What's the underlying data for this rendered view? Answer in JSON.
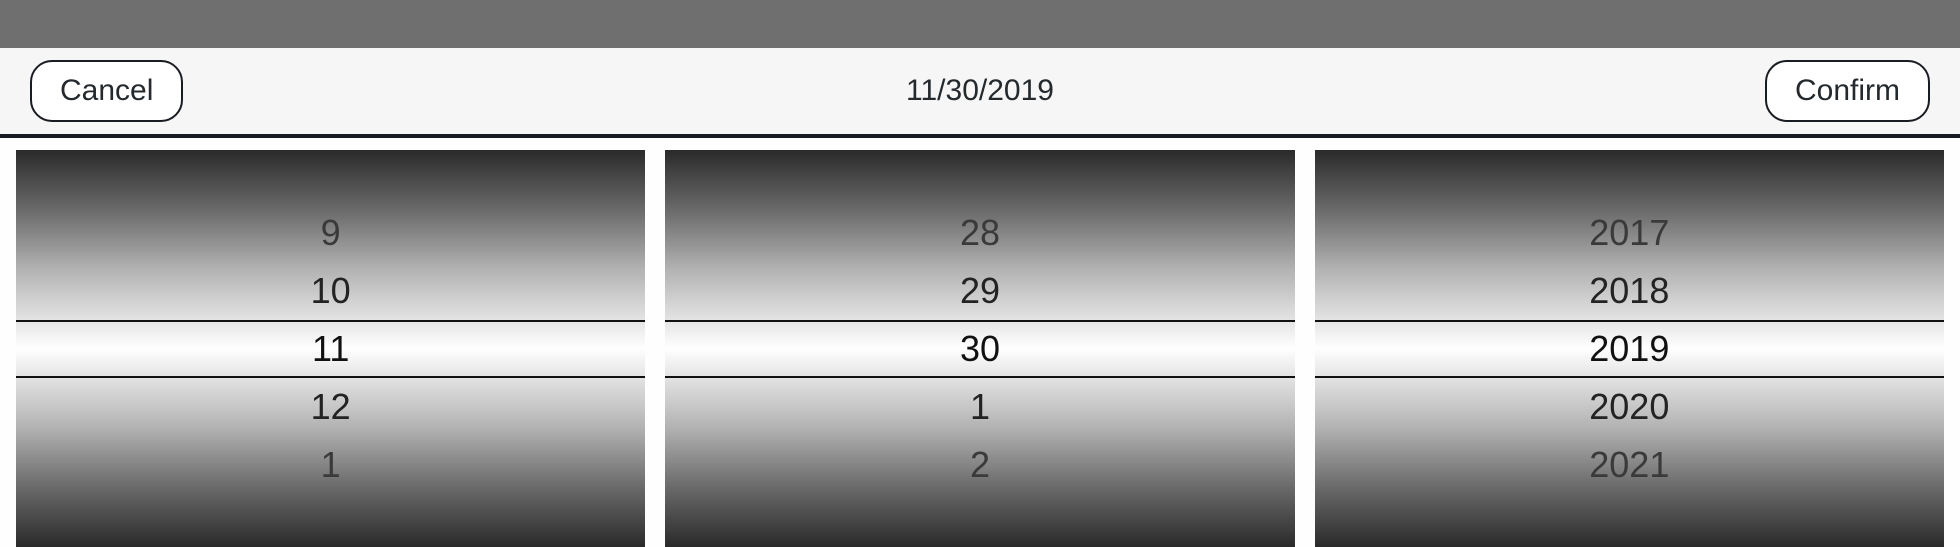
{
  "header": {
    "title": "11/30/2019",
    "cancel_label": "Cancel",
    "confirm_label": "Confirm"
  },
  "picker": {
    "month": {
      "items": [
        "9",
        "10",
        "11",
        "12",
        "1"
      ],
      "selected_index": 2
    },
    "day": {
      "items": [
        "28",
        "29",
        "30",
        "1",
        "2"
      ],
      "selected_index": 2
    },
    "year": {
      "items": [
        "2017",
        "2018",
        "2019",
        "2020",
        "2021"
      ],
      "selected_index": 2
    }
  }
}
